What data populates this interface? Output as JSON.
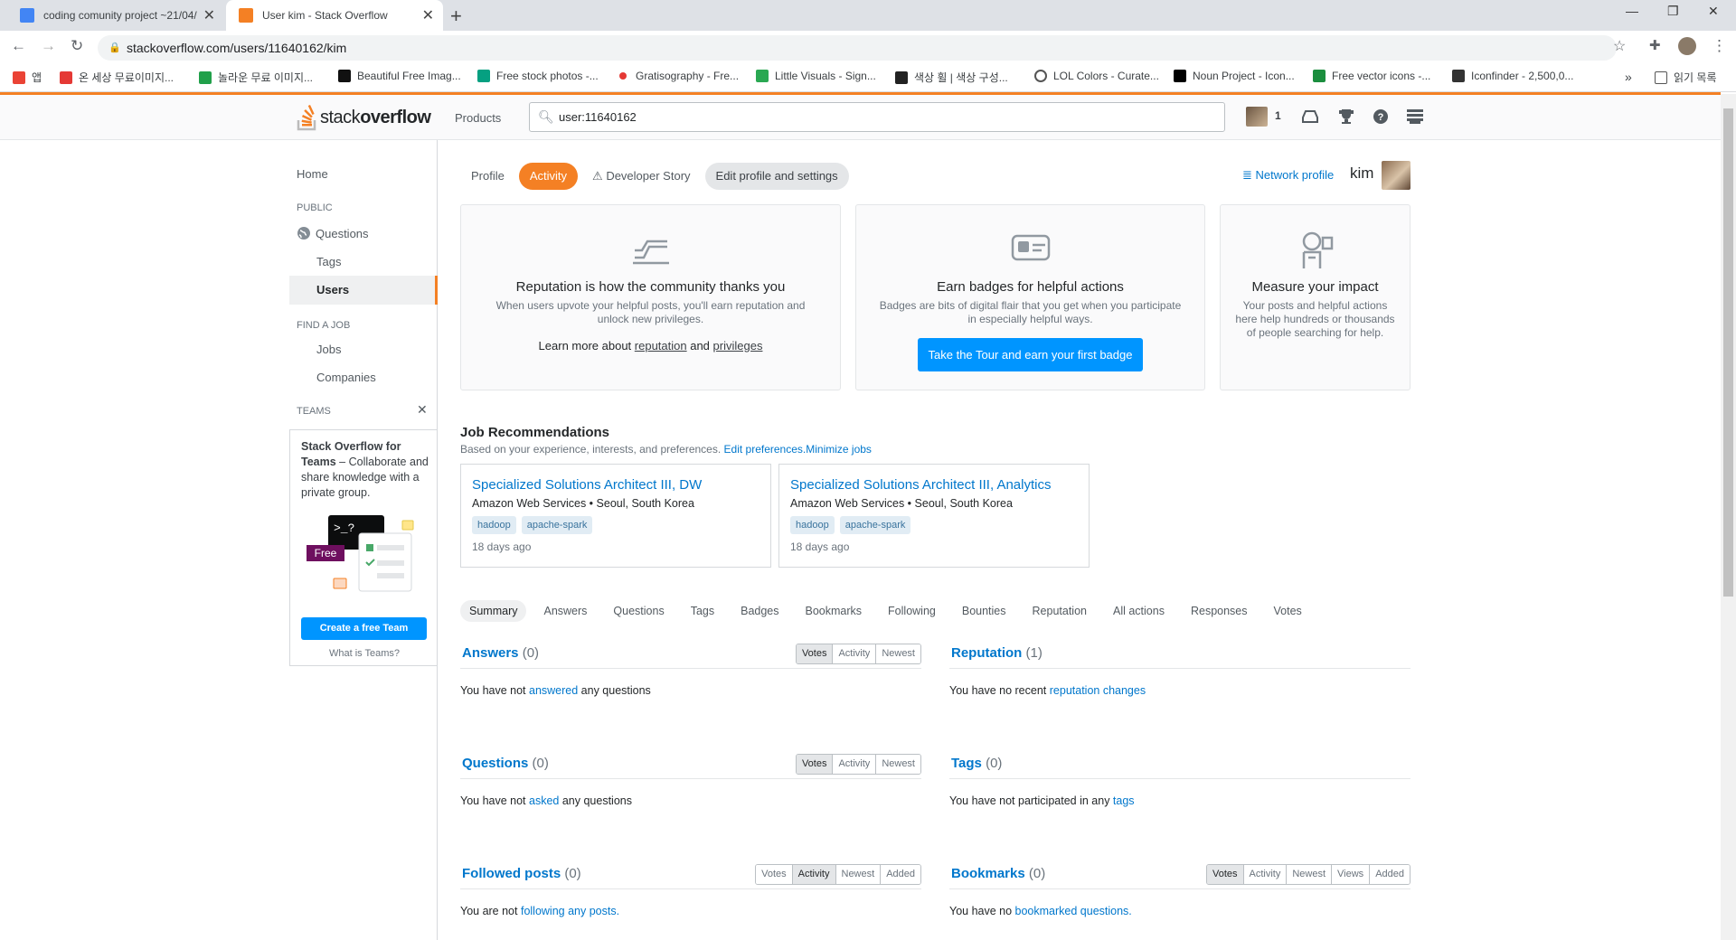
{
  "browser": {
    "tabs": [
      {
        "title": "coding comunity project ~21/04/",
        "active": false
      },
      {
        "title": "User kim - Stack Overflow",
        "active": true
      }
    ],
    "url": "stackoverflow.com/users/11640162/kim",
    "bookmarks": [
      "앱",
      "온 세상 무료이미지...",
      "놀라운 무료 이미지...",
      "Beautiful Free Imag...",
      "Free stock photos -...",
      "Gratisography - Fre...",
      "Little Visuals - Sign...",
      "색상 휠 | 색상 구성...",
      "LOL Colors - Curate...",
      "Noun Project - Icon...",
      "Free vector icons -...",
      "Iconfinder - 2,500,0..."
    ],
    "reading_list": "읽기 목록"
  },
  "header": {
    "logo_stack": "stack",
    "logo_overflow": "overflow",
    "products": "Products",
    "search_value": "user:11640162",
    "rep": "1"
  },
  "sidebar": {
    "home": "Home",
    "public_head": "PUBLIC",
    "questions": "Questions",
    "tags": "Tags",
    "users": "Users",
    "findjob_head": "FIND A JOB",
    "jobs": "Jobs",
    "companies": "Companies",
    "teams_head": "TEAMS",
    "teams_title": "Stack Overflow for Teams",
    "teams_desc": " – Collaborate and share knowledge with a private group.",
    "teams_free": "Free",
    "teams_btn": "Create a free Team",
    "teams_what": "What is Teams?"
  },
  "profile_tabs": [
    "Profile",
    "Activity",
    "Developer Story",
    "Edit profile and settings"
  ],
  "network_profile": "Network profile",
  "username": "kim",
  "cards": [
    {
      "title": "Reputation is how the community thanks you",
      "text": "When users upvote your helpful posts, you'll earn reputation and unlock new privileges.",
      "learn_pre": "Learn more about ",
      "link1": "reputation",
      "and": " and ",
      "link2": "privileges"
    },
    {
      "title": "Earn badges for helpful actions",
      "text": "Badges are bits of digital flair that you get when you participate in especially helpful ways.",
      "button": "Take the Tour and earn your first badge"
    },
    {
      "title": "Measure your impact",
      "text": "Your posts and helpful actions here help hundreds or thousands of people searching for help."
    }
  ],
  "jobs": {
    "title": "Job Recommendations",
    "subtitle": "Based on your experience, interests, and preferences. ",
    "edit": "Edit preferences.",
    "minimize": "Minimize jobs",
    "items": [
      {
        "title": "Specialized Solutions Architect III, DW",
        "company": "Amazon Web Services • Seoul, South Korea",
        "tags": [
          "hadoop",
          "apache-spark"
        ],
        "age": "18 days ago"
      },
      {
        "title": "Specialized Solutions Architect III, Analytics",
        "company": "Amazon Web Services • Seoul, South Korea",
        "tags": [
          "hadoop",
          "apache-spark"
        ],
        "age": "18 days ago"
      }
    ]
  },
  "activity_nav": [
    "Summary",
    "Answers",
    "Questions",
    "Tags",
    "Badges",
    "Bookmarks",
    "Following",
    "Bounties",
    "Reputation",
    "All actions",
    "Responses",
    "Votes"
  ],
  "sections": {
    "answers": {
      "title": "Answers",
      "count": "(0)",
      "sorts": [
        "Votes",
        "Activity",
        "Newest"
      ],
      "pre": "You have not ",
      "link": "answered",
      "post": " any questions"
    },
    "reputation": {
      "title": "Reputation",
      "count": "(1)",
      "pre": "You have no recent ",
      "link": "reputation changes",
      "post": ""
    },
    "questions": {
      "title": "Questions",
      "count": "(0)",
      "sorts": [
        "Votes",
        "Activity",
        "Newest"
      ],
      "pre": "You have not ",
      "link": "asked",
      "post": " any questions"
    },
    "tags": {
      "title": "Tags",
      "count": "(0)",
      "pre": "You have not participated in any ",
      "link": "tags",
      "post": ""
    },
    "followed": {
      "title": "Followed posts",
      "count": "(0)",
      "sorts": [
        "Votes",
        "Activity",
        "Newest",
        "Added"
      ],
      "pre": "You are not ",
      "link": "following any posts.",
      "post": ""
    },
    "bookmarks": {
      "title": "Bookmarks",
      "count": "(0)",
      "sorts": [
        "Votes",
        "Activity",
        "Newest",
        "Views",
        "Added"
      ],
      "pre": "You have no ",
      "link": "bookmarked questions.",
      "post": ""
    }
  },
  "colors": {
    "accent": "#f48024",
    "link": "#0077cc",
    "button": "#0095ff"
  }
}
